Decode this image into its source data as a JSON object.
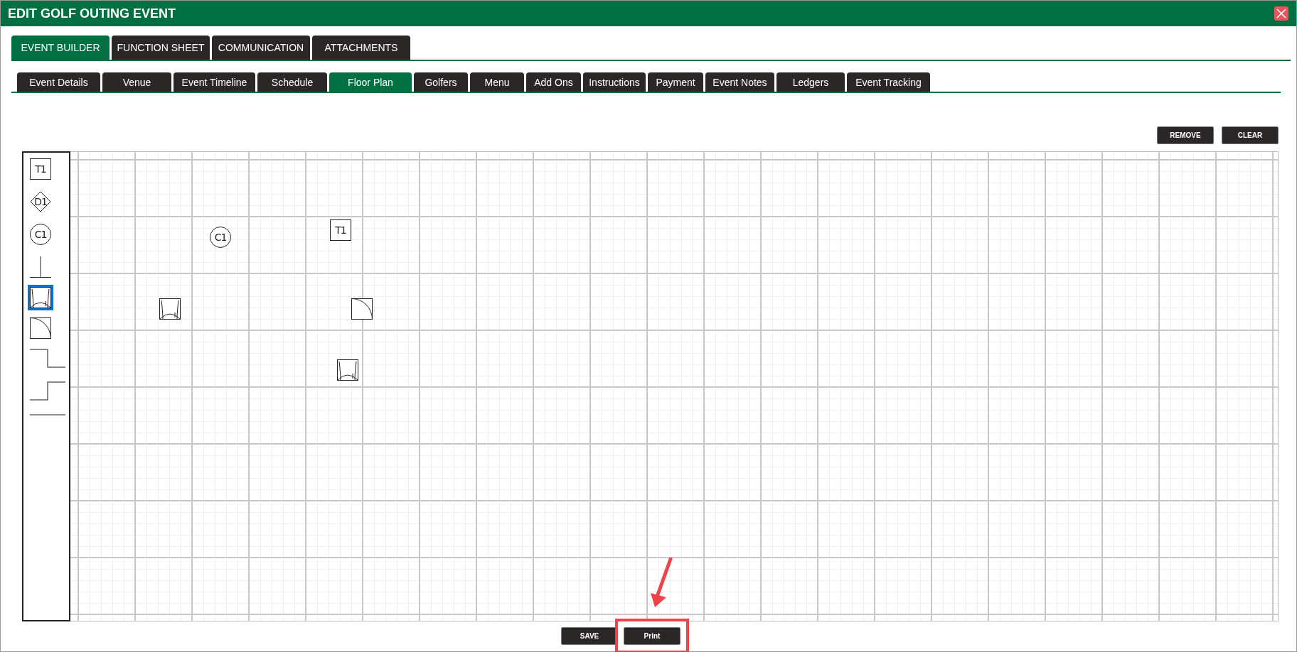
{
  "window": {
    "title": "EDIT GOLF OUTING EVENT"
  },
  "main_tabs": [
    {
      "label": "EVENT BUILDER",
      "selected": true
    },
    {
      "label": "FUNCTION SHEET",
      "selected": false
    },
    {
      "label": "COMMUNICATION",
      "selected": false
    },
    {
      "label": "ATTACHMENTS",
      "selected": false
    }
  ],
  "sub_tabs": [
    {
      "label": "Event Details",
      "selected": false
    },
    {
      "label": "Venue",
      "selected": false
    },
    {
      "label": "Event Timeline",
      "selected": false
    },
    {
      "label": "Schedule",
      "selected": false
    },
    {
      "label": "Floor Plan",
      "selected": true
    },
    {
      "label": "Golfers",
      "selected": false
    },
    {
      "label": "Menu",
      "selected": false
    },
    {
      "label": "Add Ons",
      "selected": false
    },
    {
      "label": "Instructions",
      "selected": false
    },
    {
      "label": "Payment",
      "selected": false
    },
    {
      "label": "Event Notes",
      "selected": false
    },
    {
      "label": "Ledgers",
      "selected": false
    },
    {
      "label": "Event Tracking",
      "selected": false
    }
  ],
  "toolbar_buttons": [
    "REMOVE",
    "CLEAR"
  ],
  "palette": [
    {
      "kind": "table",
      "label": "T1",
      "selected": false
    },
    {
      "kind": "diamond",
      "label": "D1",
      "selected": false
    },
    {
      "kind": "circle",
      "label": "C1",
      "selected": false
    },
    {
      "kind": "wall",
      "selected": false
    },
    {
      "kind": "chair",
      "selected": true
    },
    {
      "kind": "door",
      "selected": false
    },
    {
      "kind": "step-down",
      "selected": false
    },
    {
      "kind": "step-up",
      "selected": false
    },
    {
      "kind": "line",
      "selected": false
    }
  ],
  "floor_items": [
    {
      "kind": "table",
      "label": "T1"
    },
    {
      "kind": "circle",
      "label": "C1"
    },
    {
      "kind": "chair"
    },
    {
      "kind": "door"
    },
    {
      "kind": "chair"
    }
  ],
  "footer_buttons": [
    {
      "label": "SAVE",
      "highlighted": false
    },
    {
      "label": "Print",
      "highlighted": true
    }
  ]
}
